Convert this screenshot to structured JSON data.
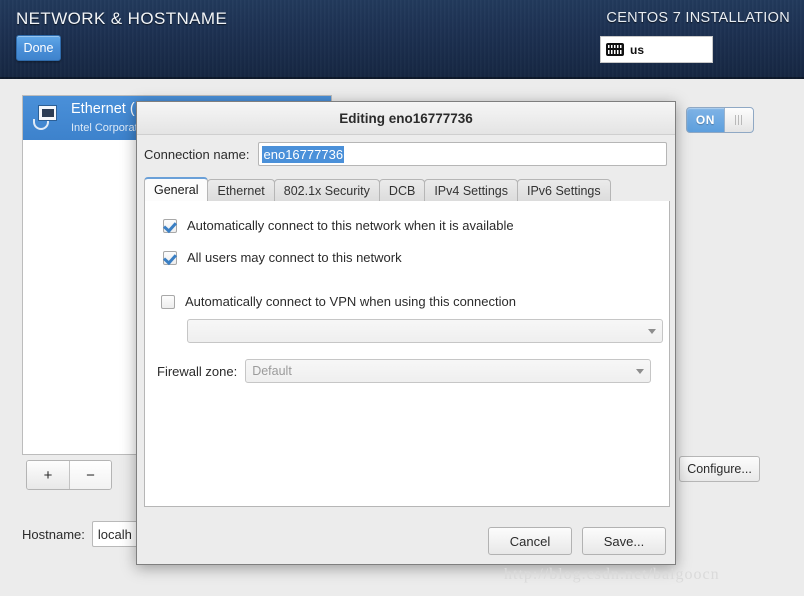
{
  "header": {
    "title": "NETWORK & HOSTNAME",
    "product": "CENTOS 7 INSTALLATION",
    "done_label": "Done",
    "keyboard_layout": "us",
    "keyboard_icon": "keyboard-icon",
    "bg_color": "#1d3152",
    "accent_color": "#4a90d9"
  },
  "device_list": {
    "items": [
      {
        "icon": "ethernet-nic-icon",
        "title": "Ethernet (",
        "subtitle": "Intel Corporat",
        "selected": true
      }
    ],
    "add_label": "+",
    "remove_label": "−"
  },
  "device_toggle": {
    "state_label": "ON",
    "on": true
  },
  "configure": {
    "label": "Configure..."
  },
  "hostname": {
    "label": "Hostname:",
    "value": "localh",
    "placeholder": ""
  },
  "dialog": {
    "title": "Editing eno16777736",
    "connection_name": {
      "label": "Connection name:",
      "value": "eno16777736",
      "selected": true,
      "selection_color": "#4a90d9"
    },
    "tabs": [
      {
        "label": "General",
        "active": true
      },
      {
        "label": "Ethernet",
        "active": false
      },
      {
        "label": "802.1x Security",
        "active": false
      },
      {
        "label": "DCB",
        "active": false
      },
      {
        "label": "IPv4 Settings",
        "active": false
      },
      {
        "label": "IPv6 Settings",
        "active": false
      }
    ],
    "general": {
      "auto_connect": {
        "label": "Automatically connect to this network when it is available",
        "checked": true
      },
      "all_users": {
        "label": "All users may connect to this network",
        "checked": true
      },
      "auto_vpn": {
        "label": "Automatically connect to VPN when using this connection",
        "checked": false
      },
      "vpn_select": {
        "value": "",
        "disabled": true
      },
      "firewall_zone": {
        "label": "Firewall zone:",
        "value": "Default",
        "disabled": true
      }
    },
    "buttons": {
      "cancel": "Cancel",
      "save": "Save..."
    }
  },
  "watermark": {
    "text": "http://blog.csdn.net/baigoocn"
  }
}
